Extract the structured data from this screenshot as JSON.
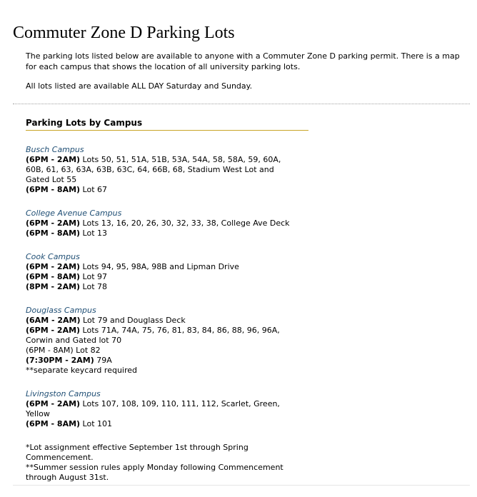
{
  "page": {
    "title": "Commuter Zone D Parking Lots",
    "intro_paragraph": "The parking lots listed below are available to anyone with a Commuter Zone D parking permit. There is a map for each campus that shows the location of all university parking lots.",
    "saturday_sunday_note": "All lots listed are available ALL DAY Saturday and Sunday."
  },
  "lots": {
    "heading": "Parking Lots by Campus",
    "campuses": [
      {
        "name": "Busch Campus",
        "entries": [
          {
            "time": "(6PM - 2AM)",
            "text": " Lots 50, 51, 51A, 51B, 53A, 54A, 58, 58A, 59, 60A, 60B, 61, 63, 63A, 63B, 63C, 64, 66B, 68, Stadium West Lot and Gated Lot 55"
          },
          {
            "time": "(6PM - 8AM)",
            "text": " Lot 67"
          }
        ]
      },
      {
        "name": "College Avenue Campus",
        "entries": [
          {
            "time": "(6PM - 2AM)",
            "text": " Lots 13, 16, 20, 26, 30, 32, 33, 38, College Ave Deck"
          },
          {
            "time": "(6PM - 8AM)",
            "text": " Lot 13"
          }
        ]
      },
      {
        "name": "Cook Campus",
        "entries": [
          {
            "time": "(6PM - 2AM)",
            "text": " Lots 94, 95, 98A, 98B and Lipman Drive"
          },
          {
            "time": "(6PM - 8AM)",
            "text": " Lot 97"
          },
          {
            "time": "(8PM - 2AM)",
            "text": " Lot 78"
          }
        ]
      },
      {
        "name": "Douglass Campus",
        "entries": [
          {
            "time": "(6AM - 2AM)",
            "text": " Lot 79 and Douglass Deck"
          },
          {
            "time": "(6PM - 2AM)",
            "text": " Lots 71A, 74A, 75, 76, 81, 83, 84, 86, 88, 96, 96A, Corwin and Gated lot 70"
          },
          {
            "time": "",
            "text": "(6PM - 8AM) Lot 82"
          },
          {
            "time": "(7:30PM - 2AM)",
            "text": " 79A"
          },
          {
            "time": "",
            "text": "**separate keycard required"
          }
        ]
      },
      {
        "name": "Livingston Campus",
        "entries": [
          {
            "time": "(6PM - 2AM)",
            "text": " Lots 107, 108, 109, 110, 111, 112, Scarlet, Green, Yellow"
          },
          {
            "time": "(6PM - 8AM)",
            "text": " Lot 101"
          }
        ]
      }
    ],
    "notes": [
      "*Lot assignment effective September 1st through Spring Commencement.",
      "**Summer session rules apply Monday following Commencement through August 31st."
    ]
  }
}
